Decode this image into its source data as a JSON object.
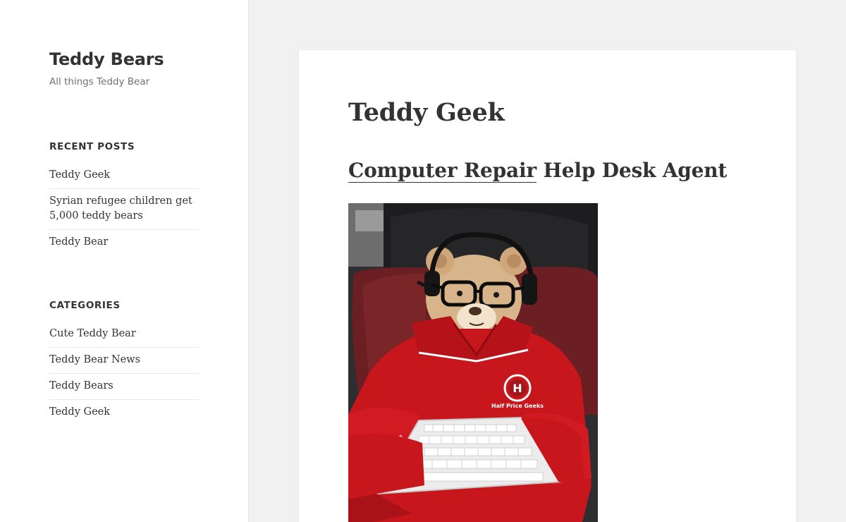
{
  "site": {
    "title": "Teddy Bears",
    "description": "All things Teddy Bear"
  },
  "sidebar": {
    "recent_posts": {
      "title": "Recent Posts",
      "items": [
        {
          "label": "Teddy Geek"
        },
        {
          "label": "Syrian refugee children get 5,000 teddy bears"
        },
        {
          "label": "Teddy Bear"
        }
      ]
    },
    "categories": {
      "title": "Categories",
      "items": [
        {
          "label": "Cute Teddy Bear"
        },
        {
          "label": "Teddy Bear News"
        },
        {
          "label": "Teddy Bears"
        },
        {
          "label": "Teddy Geek"
        }
      ]
    }
  },
  "main": {
    "page_title": "Teddy Geek",
    "heading_link": "Computer Repair",
    "heading_rest": " Help Desk Agent",
    "image": {
      "logo_text": "Half Price Geeks",
      "logo_letter": "H"
    }
  },
  "colors": {
    "background": "#f1f1f1",
    "text": "#333333",
    "muted": "#707070",
    "shirt_red": "#c8161d"
  }
}
